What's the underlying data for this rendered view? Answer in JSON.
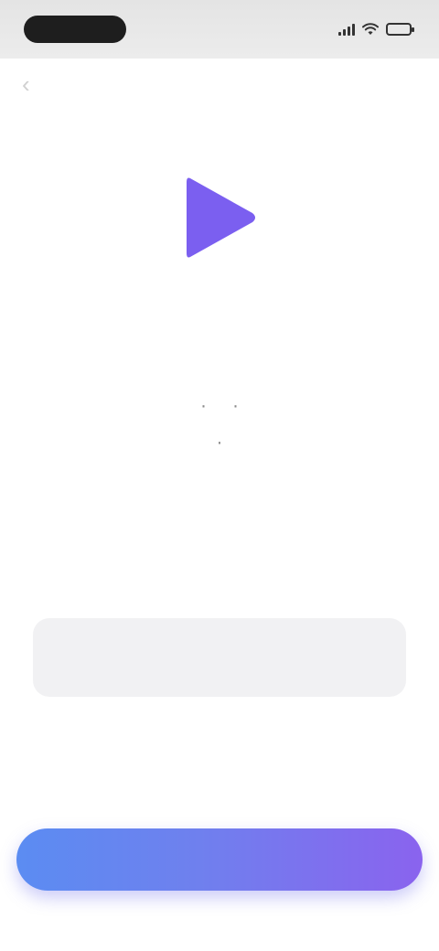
{
  "status_bar": {
    "time": "",
    "icons": [
      "signal-icon",
      "wifi-icon",
      "battery-icon"
    ]
  },
  "nav": {
    "back_icon": "chevron-left-icon"
  },
  "logo": {
    "icon": "play-triangle-icon",
    "color": "#7b5ff0"
  },
  "app": {
    "title": "",
    "tags_line1": [
      "",
      "",
      ""
    ],
    "tags_line2": [
      "",
      ""
    ],
    "description": "",
    "info_note": ""
  },
  "primary_action": {
    "label": ""
  },
  "colors": {
    "accent_start": "#5b8cf2",
    "accent_end": "#8a63ee",
    "status_pill": "#1e1e1e"
  }
}
